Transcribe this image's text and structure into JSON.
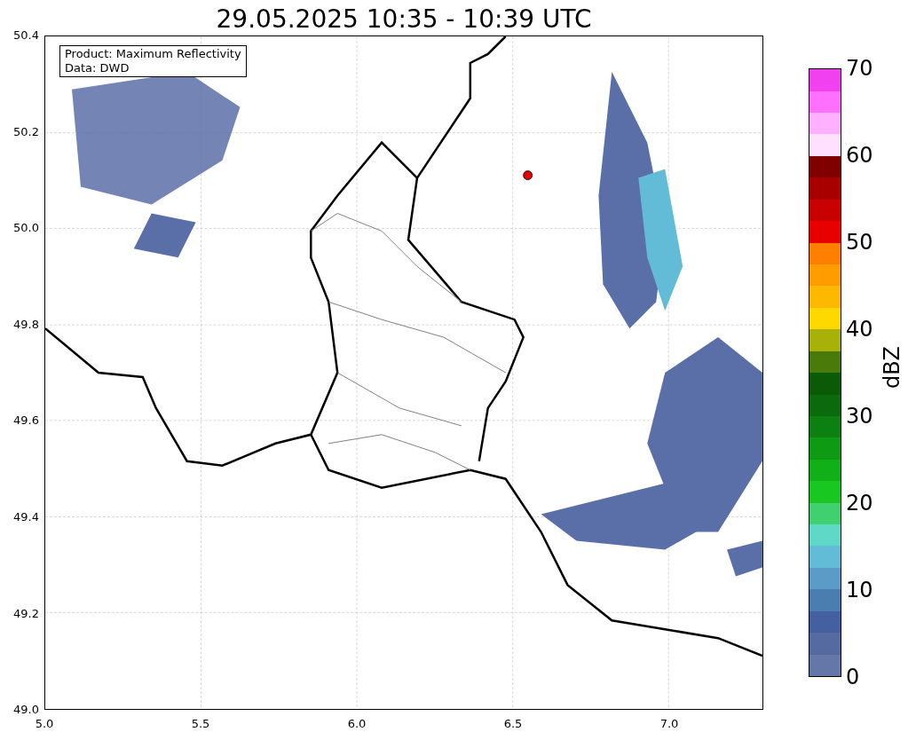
{
  "title": "29.05.2025 10:35 - 10:39 UTC",
  "info_box": {
    "lines": [
      "Product: Maximum Reflectivity",
      "Data: DWD"
    ]
  },
  "x_ticks": [
    "5.0",
    "5.5",
    "6.0",
    "6.5",
    "7.0"
  ],
  "y_ticks": [
    "50.4",
    "50.2",
    "50.0",
    "49.8",
    "49.6",
    "49.4",
    "49.2",
    "49.0"
  ],
  "colorbar": {
    "label": "dBZ",
    "ticks": [
      "70",
      "60",
      "50",
      "40",
      "30",
      "20",
      "10",
      "0"
    ]
  }
}
